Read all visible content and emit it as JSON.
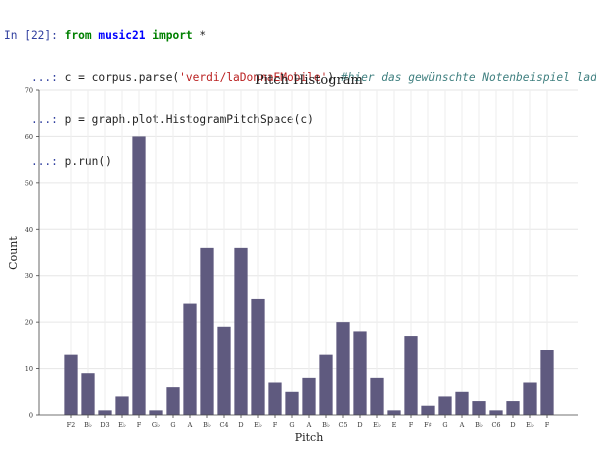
{
  "cell": {
    "prompt": "In [22]:",
    "continuation": "...:",
    "line1": {
      "kw_from": "from",
      "module": "music21",
      "kw_import": "import",
      "star": "*"
    },
    "line2": {
      "code": "c = corpus.parse(",
      "string": "'verdi/laDonnaEMobile'",
      "close": ")",
      "comment": "#hier das gewünschte Notenbeispiel laden"
    },
    "line3": {
      "code": "p = graph.plot.HistogramPitchSpace(c)"
    },
    "line4": {
      "code": "p.run()"
    }
  },
  "chart_data": {
    "type": "bar",
    "title": "Pitch Histogram",
    "xlabel": "Pitch",
    "ylabel": "Count",
    "ylim": [
      0,
      70
    ],
    "yticks": [
      0,
      10,
      20,
      30,
      40,
      50,
      60,
      70
    ],
    "grid": true,
    "categories": [
      "F2",
      "B♭",
      "D3",
      "E♭",
      "F",
      "G♭",
      "G",
      "A",
      "B♭",
      "C4",
      "D",
      "E♭",
      "F",
      "G",
      "A",
      "B♭",
      "C5",
      "D",
      "E♭",
      "E",
      "F",
      "F♯",
      "G",
      "A",
      "B♭",
      "C6",
      "D",
      "E♭",
      "F"
    ],
    "values": [
      13,
      9,
      1,
      4,
      60,
      1,
      6,
      24,
      36,
      19,
      36,
      25,
      7,
      5,
      8,
      13,
      20,
      18,
      8,
      1,
      17,
      2,
      4,
      5,
      3,
      1,
      3,
      7,
      14
    ],
    "bar_color": "#5f5a7f"
  }
}
